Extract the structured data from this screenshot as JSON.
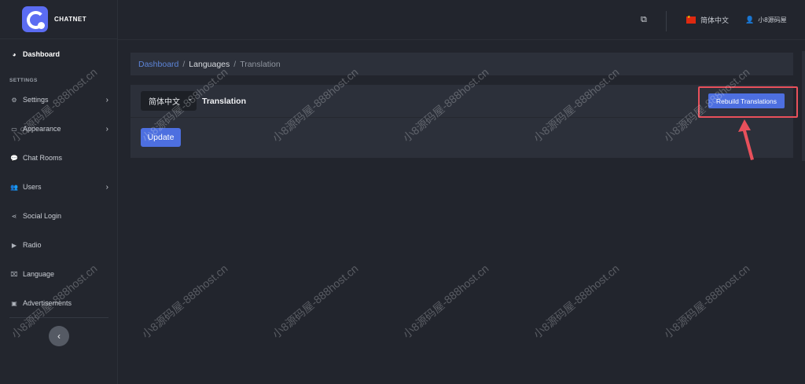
{
  "brand": {
    "name": "CHATNET"
  },
  "sidebar": {
    "section_label": "SETTINGS",
    "items": [
      {
        "label": "Dashboard",
        "icon": "dashboard-icon",
        "glyph": "◕"
      },
      {
        "label": "Settings",
        "icon": "gear-icon",
        "glyph": "⚙"
      },
      {
        "label": "Appearance",
        "icon": "window-icon",
        "glyph": "▭"
      },
      {
        "label": "Chat Rooms",
        "icon": "chat-icon",
        "glyph": "💬"
      },
      {
        "label": "Users",
        "icon": "users-icon",
        "glyph": "👥"
      },
      {
        "label": "Social Login",
        "icon": "share-icon",
        "glyph": "⋖"
      },
      {
        "label": "Radio",
        "icon": "play-circle-icon",
        "glyph": "▶"
      },
      {
        "label": "Language",
        "icon": "language-icon",
        "glyph": "⌧"
      },
      {
        "label": "Advertisements",
        "icon": "ad-icon",
        "glyph": "▣"
      }
    ],
    "collapse_glyph": "‹"
  },
  "topbar": {
    "language": "简体中文",
    "user": "小8源码屋"
  },
  "breadcrumb": {
    "items": [
      "Dashboard",
      "Languages",
      "Translation"
    ],
    "separator": "/"
  },
  "panel": {
    "selected_language": "简体中文",
    "title": "Translation",
    "rebuild_label": "Rebuild Translations",
    "update_label": "Update"
  },
  "watermark": "小8源码屋-888host.cn",
  "colors": {
    "accent": "#4d6fe0",
    "link": "#5d85d9",
    "highlight": "#e8505b"
  }
}
